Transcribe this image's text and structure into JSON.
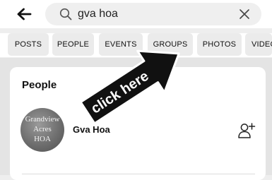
{
  "search": {
    "query": "gva hoa"
  },
  "tabs": [
    {
      "label": "POSTS"
    },
    {
      "label": "PEOPLE"
    },
    {
      "label": "EVENTS"
    },
    {
      "label": "GROUPS"
    },
    {
      "label": "PHOTOS"
    },
    {
      "label": "VIDEOS"
    }
  ],
  "people": {
    "title": "People",
    "results": [
      {
        "name": "Gva Hoa",
        "avatar_lines": [
          "Grandview",
          "Acres",
          "HOA"
        ]
      }
    ]
  },
  "annotation": {
    "text": "click here",
    "points_to": "GROUPS"
  },
  "icons": {
    "back": "arrow-left-icon",
    "search": "search-icon",
    "clear": "close-icon",
    "add_friend": "add-person-icon"
  },
  "colors": {
    "page_background": "#eeeeee",
    "card": "#ffffff",
    "chip": "#ebebeb",
    "annotation": "#111111"
  }
}
